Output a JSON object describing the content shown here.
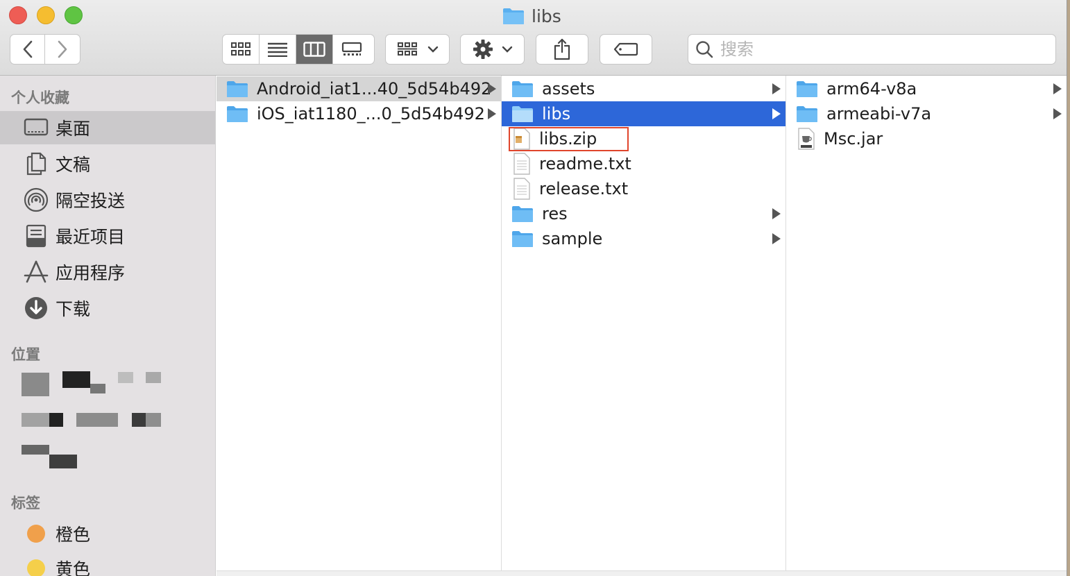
{
  "window": {
    "title": "libs"
  },
  "toolbar": {
    "search_placeholder": "搜索",
    "nav_buttons": [
      "back",
      "forward"
    ],
    "view_modes": [
      "icon-view",
      "list-view",
      "column-view",
      "gallery-view"
    ],
    "active_view": "column-view"
  },
  "sidebar": {
    "favorites_title": "个人收藏",
    "favorites": [
      {
        "label": "桌面",
        "icon": "desktop-icon",
        "selected": true
      },
      {
        "label": "文稿",
        "icon": "documents-icon"
      },
      {
        "label": "隔空投送",
        "icon": "airdrop-icon"
      },
      {
        "label": "最近项目",
        "icon": "recents-icon"
      },
      {
        "label": "应用程序",
        "icon": "applications-icon"
      },
      {
        "label": "下载",
        "icon": "downloads-icon"
      }
    ],
    "locations_title": "位置",
    "tags_title": "标签",
    "tags": [
      {
        "label": "橙色",
        "color": "#f0a04b"
      },
      {
        "label": "黄色",
        "color": "#f5cf4a"
      }
    ]
  },
  "columns": [
    {
      "items": [
        {
          "name": "Android_iat1...40_5d54b492",
          "kind": "folder",
          "has_children": true,
          "state": "parent-selected"
        },
        {
          "name": "iOS_iat1180_...0_5d54b492",
          "kind": "folder",
          "has_children": true
        }
      ]
    },
    {
      "items": [
        {
          "name": "assets",
          "kind": "folder",
          "has_children": true
        },
        {
          "name": "libs",
          "kind": "folder",
          "has_children": true,
          "state": "selected"
        },
        {
          "name": "libs.zip",
          "kind": "zip",
          "has_children": false,
          "highlighted": true
        },
        {
          "name": "readme.txt",
          "kind": "text",
          "has_children": false
        },
        {
          "name": "release.txt",
          "kind": "text",
          "has_children": false
        },
        {
          "name": "res",
          "kind": "folder",
          "has_children": true
        },
        {
          "name": "sample",
          "kind": "folder",
          "has_children": true
        }
      ]
    },
    {
      "items": [
        {
          "name": "arm64-v8a",
          "kind": "folder",
          "has_children": true
        },
        {
          "name": "armeabi-v7a",
          "kind": "folder",
          "has_children": true
        },
        {
          "name": "Msc.jar",
          "kind": "jar",
          "has_children": false
        }
      ]
    }
  ],
  "colors": {
    "selection": "#2d67d9",
    "folder": "#5ab0f0",
    "highlight_border": "#e0452c"
  }
}
